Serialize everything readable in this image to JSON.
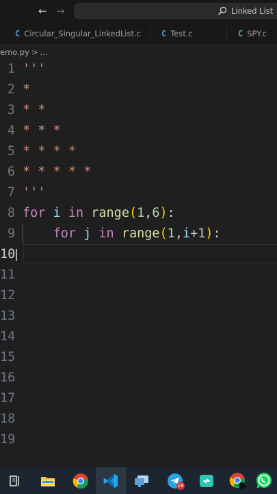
{
  "titlebar": {
    "back_icon": "arrow-left-icon",
    "forward_icon": "arrow-right-icon",
    "search_text": "Linked List",
    "search_icon": "search-icon"
  },
  "tabs": [
    {
      "lang": "C",
      "label": "Circular_Singular_LinkedList.c"
    },
    {
      "lang": "C",
      "label": "Test.c"
    },
    {
      "lang": "C",
      "label": "SPY.c"
    }
  ],
  "breadcrumb": {
    "file": "emo.py",
    "separator": ">",
    "symbol": "..."
  },
  "editor": {
    "line_numbers": [
      "1",
      "2",
      "3",
      "4",
      "5",
      "6",
      "7",
      "8",
      "9",
      "10",
      "11",
      "12",
      "13",
      "14",
      "15",
      "16",
      "17",
      "18",
      "19"
    ],
    "active_line": "10",
    "code": {
      "l1": "'''",
      "l2": "*",
      "l3": "* *",
      "l4": "* * *",
      "l5": "* * * *",
      "l6": "* * * * *",
      "l7": "'''",
      "l8": {
        "kw_for": "for",
        "var_i": "i",
        "kw_in": "in",
        "fn_range": "range",
        "open": "(",
        "n1": "1",
        "comma": ",",
        "n2": "6",
        "close": ")",
        "colon": ":"
      },
      "l9": {
        "kw_for": "for",
        "var_j": "j",
        "kw_in": "in",
        "fn_range": "range",
        "open": "(",
        "n1": "1",
        "comma": ",",
        "var_i": "i",
        "plus": "+",
        "n2": "1",
        "close": ")",
        "colon": ":"
      }
    }
  },
  "taskbar": {
    "items": [
      "task-view-icon",
      "file-explorer-icon",
      "chrome-icon",
      "vscode-icon",
      "remote-desktop-icon",
      "telegram-icon",
      "sync-app-icon",
      "chrome-profile-icon",
      "whatsapp-icon"
    ],
    "telegram_badge": "18"
  },
  "colors": {
    "background": "#1f1f1f",
    "keyword": "#c586c0",
    "string": "#ce9178",
    "function": "#dcdcaa",
    "variable": "#9cdcfe",
    "number": "#b5cea8",
    "bracket_level1": "#ffd700",
    "bracket_level2": "#da70d6",
    "c_file_icon": "#519aba"
  }
}
